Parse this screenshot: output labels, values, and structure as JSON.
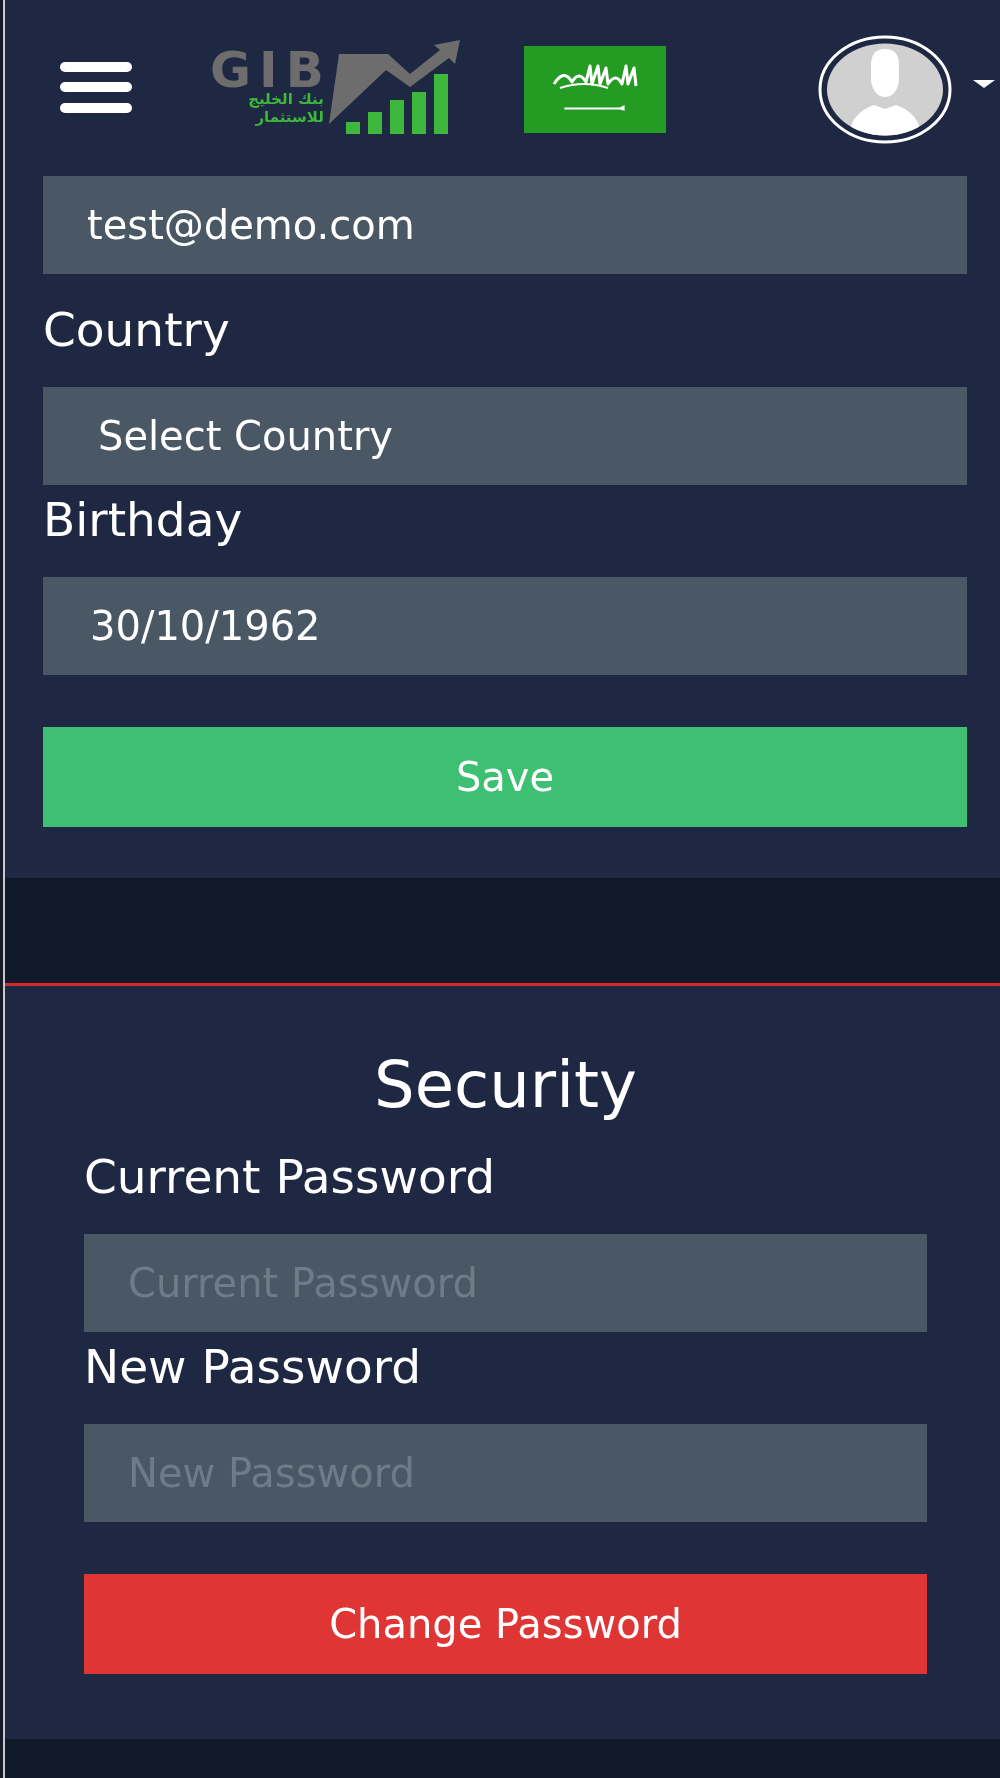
{
  "header": {
    "logo": {
      "wordmark": "GIB",
      "arabic_lines": [
        "بنك الخليج",
        "للاستثمار"
      ]
    }
  },
  "profile_form": {
    "fields": [
      {
        "kind": "email",
        "value": "test@demo.com"
      },
      {
        "kind": "select",
        "label": "Country",
        "value": "Select Country"
      },
      {
        "kind": "date",
        "label": "Birthday",
        "value": "30/10/1962"
      }
    ],
    "save_button": "Save"
  },
  "security": {
    "title": "Security",
    "fields": [
      {
        "label": "Current Password",
        "placeholder": "Current Password"
      },
      {
        "label": "New Password",
        "placeholder": "New Password"
      }
    ],
    "button": "Change Password"
  }
}
